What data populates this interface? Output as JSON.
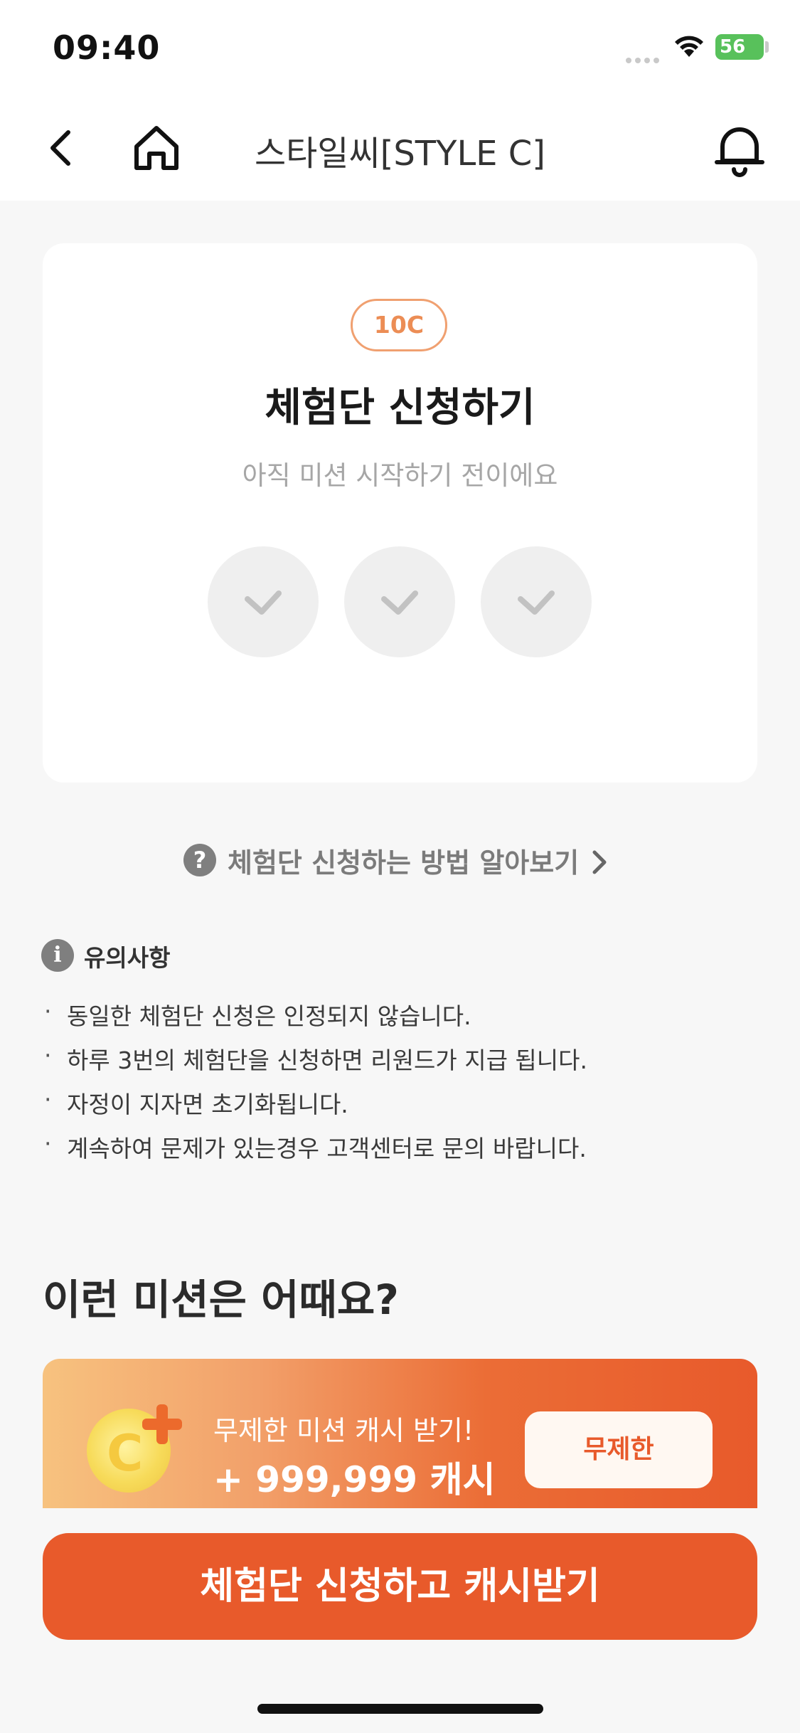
{
  "status_bar": {
    "time": "09:40",
    "battery": "56"
  },
  "nav": {
    "title": "스타일씨[STYLE C]",
    "back_icon": "chevron-left-icon",
    "home_icon": "home-icon",
    "bell_icon": "bell-icon"
  },
  "card": {
    "badge": "10C",
    "title": "체험단 신청하기",
    "subtitle": "아직 미션 시작하기 전이에요",
    "steps": [
      "check-icon",
      "check-icon",
      "check-icon"
    ]
  },
  "howto": {
    "label": "체험단 신청하는 방법 알아보기",
    "icon": "question-icon"
  },
  "notice": {
    "title": "유의사항",
    "icon": "info-icon",
    "items": [
      "동일한 체험단 신청은 인정되지 않습니다.",
      "하루 3번의 체험단을 신청하면 리원드가 지급 됩니다.",
      "자정이 지자면 초기화됩니다.",
      "계속하여 문제가 있는경우 고객센터로 문의 바랍니다."
    ]
  },
  "recommend": {
    "title": "이런 미션은 어때요?",
    "promo": {
      "line1": "무제한 미션 캐시 받기!",
      "line2": "+ 999,999 캐시",
      "button": "무제한"
    }
  },
  "cta": {
    "label": "체험단 신청하고 캐시받기"
  },
  "colors": {
    "accent": "#e85a2b",
    "badge_border": "#f0a070",
    "battery": "#58c15b"
  }
}
